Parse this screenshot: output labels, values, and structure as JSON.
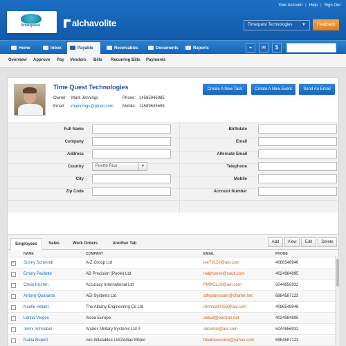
{
  "top_links": [
    "Your Account",
    "Help",
    "Sign Out"
  ],
  "logo": {
    "text": "timequest"
  },
  "brand": {
    "name": "alchavolite"
  },
  "company_select": {
    "value": "Timequest Technologies"
  },
  "feedback_label": "Feedback",
  "nav": {
    "items": [
      {
        "label": "Home",
        "icon": "home-icon"
      },
      {
        "label": "Inbox",
        "icon": "inbox-icon"
      },
      {
        "label": "Payable",
        "icon": "payable-icon",
        "active": true
      },
      {
        "label": "Receivables",
        "icon": "receivables-icon"
      },
      {
        "label": "Documents",
        "icon": "documents-icon"
      },
      {
        "label": "Reports",
        "icon": "reports-icon"
      }
    ],
    "icon_buttons": [
      "+",
      "✉",
      "$"
    ]
  },
  "subnav": [
    "Overview",
    "Approve",
    "Pay",
    "Vendors",
    "Bills",
    "Recurring Bills",
    "Payments"
  ],
  "profile": {
    "company": "Time Quest Technologies",
    "owner_label": "Owner:",
    "owner": "Mark Jennings",
    "email_label": "Email:",
    "email": "mjennings@gmail.com",
    "phone_label": "Phone:",
    "phone": "14585946985",
    "mobile_label": "Mobile:",
    "mobile": "14589635698",
    "actions": [
      "Create A New Task",
      "Create A New Event",
      "Send An Email"
    ]
  },
  "form": {
    "left": [
      {
        "label": "Full Name",
        "value": ""
      },
      {
        "label": "Company",
        "value": ""
      },
      {
        "label": "Address",
        "value": ""
      },
      {
        "label": "Country",
        "value": "Puerto Rico",
        "select": true
      },
      {
        "label": "City",
        "value": ""
      },
      {
        "label": "Zip Code",
        "value": ""
      }
    ],
    "right": [
      {
        "label": "Birthdate",
        "value": ""
      },
      {
        "label": "Email",
        "value": ""
      },
      {
        "label": "Alternate Email",
        "value": ""
      },
      {
        "label": "Telephone",
        "value": ""
      },
      {
        "label": "Mobile",
        "value": ""
      },
      {
        "label": "Account Number",
        "value": ""
      }
    ]
  },
  "tabs": [
    "Employees",
    "Sales",
    "Work Orders",
    "Another Tab"
  ],
  "toolbar": [
    "Add",
    "View",
    "Edit",
    "Delete"
  ],
  "table": {
    "headers": [
      "NAME",
      "COMPANY",
      "EMAIL",
      "PHONE"
    ],
    "rows": [
      {
        "checked": true,
        "name": "Sunny Schwindt",
        "company": "A-Z Group Ltd",
        "email": "lee73120@aol.com",
        "phone": "4086548946"
      },
      {
        "checked": false,
        "name": "Emory Paulette",
        "company": "AB Precision (Poole) Ltd",
        "email": "rlalphonse@sault.com",
        "phone": "4024984895"
      },
      {
        "checked": false,
        "name": "Clelia Krumm",
        "company": "Accuracy International Ltd",
        "email": "PMACLJA@aol.com",
        "phone": "5044856932"
      },
      {
        "checked": false,
        "name": "Antony Quaranta",
        "company": "AEI Systems Ltd",
        "email": "alfranbensam@charter.net",
        "phone": "6984587123"
      },
      {
        "checked": false,
        "name": "Noelle Hebert",
        "company": "The Albany Engineering Co Ltd",
        "email": "rbnhood0063@aol.com",
        "phone": "4086548946"
      },
      {
        "checked": false,
        "name": "Lenita Verges",
        "company": "Alcoa Europe",
        "email": "asku3@verizon.net",
        "phone": "4024984895"
      },
      {
        "checked": false,
        "name": "Jenni Schnabel",
        "company": "Analox Military Systems Ltd   A",
        "email": "alicemie@aol.com",
        "phone": "5044856932"
      },
      {
        "checked": false,
        "name": "Nakia Rupert",
        "company": "von Inflatables Ltd/Zodiac Milpro",
        "email": "bevilnewsome@yahoo.com",
        "phone": "6984587123"
      }
    ]
  }
}
